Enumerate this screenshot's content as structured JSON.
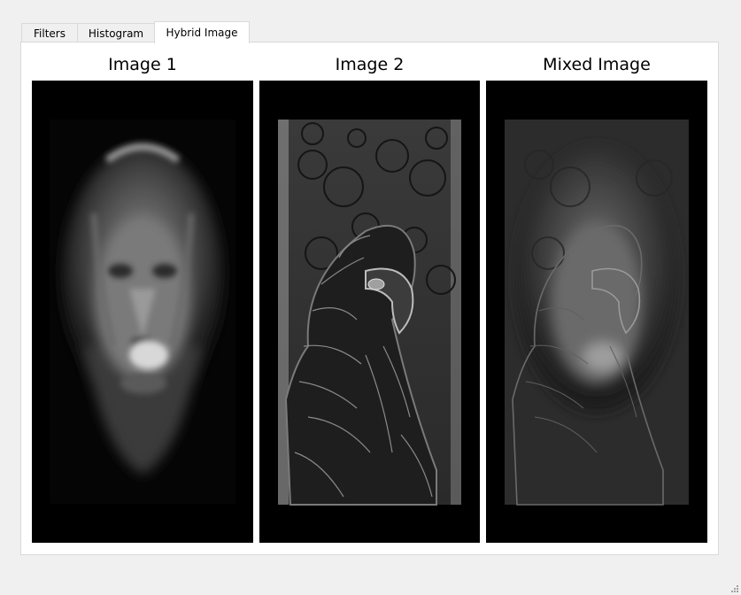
{
  "tabs": [
    {
      "label": "Filters",
      "active": false
    },
    {
      "label": "Histogram",
      "active": false
    },
    {
      "label": "Hybrid Image",
      "active": true
    }
  ],
  "panels": [
    {
      "title": "Image 1",
      "content": "blurred-lion-photo"
    },
    {
      "title": "Image 2",
      "content": "high-pass-parrot-photo"
    },
    {
      "title": "Mixed Image",
      "content": "hybrid-lion-parrot-photo"
    }
  ],
  "colors": {
    "window_bg": "#f0f0f0",
    "panel_bg": "#ffffff",
    "view_bg": "#000000"
  }
}
